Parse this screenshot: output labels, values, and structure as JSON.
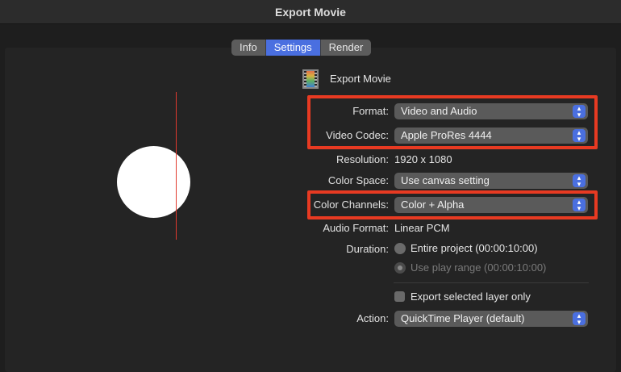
{
  "window": {
    "title": "Export Movie"
  },
  "tabs": [
    {
      "label": "Info",
      "active": false
    },
    {
      "label": "Settings",
      "active": true
    },
    {
      "label": "Render",
      "active": false
    }
  ],
  "header": {
    "icon": "film-strip-icon",
    "label": "Export Movie"
  },
  "form": {
    "format": {
      "label": "Format:",
      "value": "Video and Audio"
    },
    "video_codec": {
      "label": "Video Codec:",
      "value": "Apple ProRes 4444"
    },
    "resolution": {
      "label": "Resolution:",
      "value": "1920 x 1080"
    },
    "color_space": {
      "label": "Color Space:",
      "value": "Use canvas setting"
    },
    "color_channels": {
      "label": "Color Channels:",
      "value": "Color + Alpha"
    },
    "audio_format": {
      "label": "Audio Format:",
      "value": "Linear PCM"
    },
    "duration": {
      "label": "Duration:",
      "options": [
        {
          "label": "Entire project (00:00:10:00)",
          "selected": false
        },
        {
          "label": "Use play range (00:00:10:00)",
          "selected": true,
          "disabled": true
        }
      ]
    },
    "export_selected": {
      "label": "Export selected layer only",
      "checked": false
    },
    "action": {
      "label": "Action:",
      "value": "QuickTime Player (default)"
    }
  },
  "colors": {
    "accent": "#4a6fe0",
    "highlight_box": "#e83a22",
    "preview_line": "#e03a2e"
  }
}
